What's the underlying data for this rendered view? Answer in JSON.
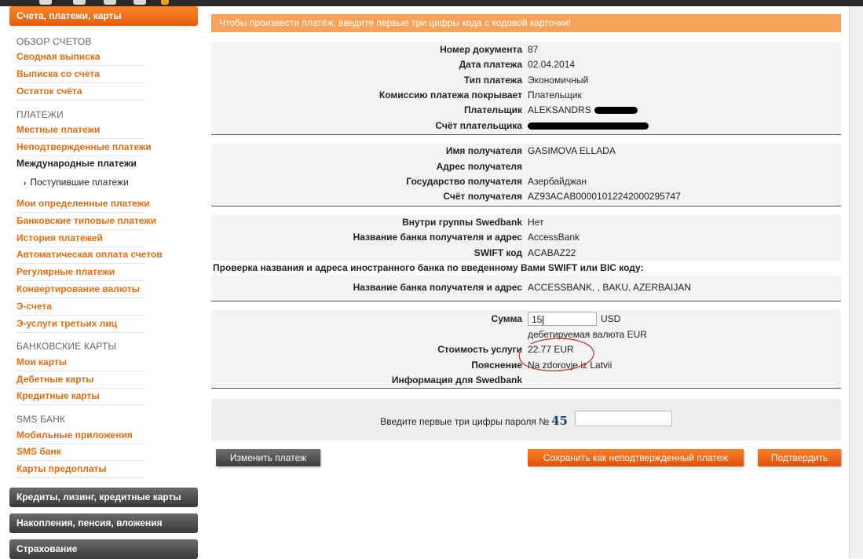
{
  "sidebar": {
    "top_header": "Счета, платежи, карты",
    "sections": [
      {
        "title": "ОБЗОР СЧЕТОВ",
        "links": [
          "Сводная выписка",
          "Выписка со счета",
          "Остаток счёта"
        ]
      },
      {
        "title": "ПЛАТЕЖИ",
        "links": [
          "Местные платежи",
          "Неподтвержденные платежи",
          "Международные платежи",
          "Поступившие платежи",
          "Мои определенные платежи",
          "Банковские типовые платежи",
          "История платежей",
          "Автоматическая оплата счетов",
          "Регулярные платежи",
          "Конвертирование валюты",
          "Э-счета",
          "Э-услуги третьих лиц"
        ]
      },
      {
        "title": "БАНКОВСКИЕ КАРТЫ",
        "links": [
          "Мои карты",
          "Дебетные карты",
          "Кредитные карты"
        ]
      },
      {
        "title": "SMS БАНК",
        "links": [
          "Мобильные приложения",
          "SMS банк",
          "Карты предоплаты"
        ]
      }
    ],
    "bottom_headers": [
      "Кредиты, лизинг, кредитные карты",
      "Накопления, пенсия, вложения",
      "Страхование"
    ]
  },
  "notice": "Чтобы произвести платёж, введите первые три цифры кода с кодовой карточки!",
  "payment": {
    "doc_number_label": "Номер документа",
    "doc_number": "87",
    "date_label": "Дата платежа",
    "date": "02.04.2014",
    "type_label": "Тип платежа",
    "type": "Экономичный",
    "commission_label": "Комиссию платежа покрывает",
    "commission": "Плательщик",
    "payer_label": "Плательщик",
    "payer": "ALEKSANDRS",
    "payer_account_label": "Счёт плательщика"
  },
  "recipient": {
    "name_label": "Имя получателя",
    "name": "GASIMOVA ELLADA",
    "address_label": "Адрес получателя",
    "address": "",
    "country_label": "Государство получателя",
    "country": "Азербайджан",
    "account_label": "Счёт получателя",
    "account": "AZ93ACAB00001012242000295747"
  },
  "bank": {
    "within_group_label": "Внутри группы Swedbank",
    "within_group": "Нет",
    "bank_name_label": "Название банка получателя и адрес",
    "bank_name": "AccessBank",
    "swift_label": "SWIFT код",
    "swift": "ACABAZ22",
    "check_text": "Проверка названия и адреса иностранного банка по введенному Вами SWIFT или BIC коду:",
    "checked_name_label": "Название банка получателя и адрес",
    "checked_name": "ACCESSBANK, , BAKU, AZERBAIJAN"
  },
  "amount": {
    "sum_label": "Сумма",
    "sum_value": "15",
    "currency": "USD",
    "debit_currency_text": "дебетируемая валюта EUR",
    "fee_label": "Стоимость услуги",
    "fee": "22.77 EUR",
    "explanation_label": "Пояснение",
    "explanation": "Na zdorovje iz Latvii",
    "info_label": "Информация для Swedbank",
    "info": ""
  },
  "password": {
    "label": "Введите первые три цифры пароля №",
    "number": "45"
  },
  "buttons": {
    "edit": "Изменить платеж",
    "save_unconfirmed": "Сохранить как неподтвержденный платеж",
    "confirm": "Подтвердить"
  },
  "colors": {
    "accent": "#e85d0c",
    "link": "#e06d13",
    "notice": "#f7a25a",
    "annotation": "#c0302a"
  }
}
